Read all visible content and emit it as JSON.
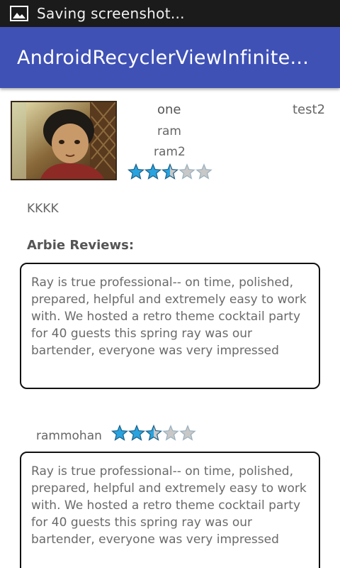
{
  "status_bar": {
    "text": "Saving screenshot...",
    "icon": "image-icon"
  },
  "app_bar": {
    "title": "AndroidRecyclerViewInfinite..."
  },
  "profile": {
    "name": "one",
    "tag": "test2",
    "line1": "ram",
    "line2": "ram2",
    "rating": 2.5,
    "rating_max": 5,
    "note": "KKKK"
  },
  "reviews": {
    "heading": "Arbie Reviews:",
    "first_text": "Ray is true professional-- on time, polished, prepared, helpful and extremely easy to work with. We hosted a retro theme cocktail party for 40 guests this spring ray was our bartender, everyone was very impressed",
    "reviewer": "rammohan",
    "reviewer_rating": 2.5,
    "second_text": "Ray is true professional-- on time, polished, prepared, helpful and extremely easy to work with. We hosted a retro theme cocktail party for 40 guests this spring ray was our bartender, everyone was very impressed"
  },
  "colors": {
    "app_bar": "#3f51b5",
    "status_bar": "#1b1b1b",
    "star_filled": "#29a3df",
    "star_empty": "#c8c8c8"
  }
}
